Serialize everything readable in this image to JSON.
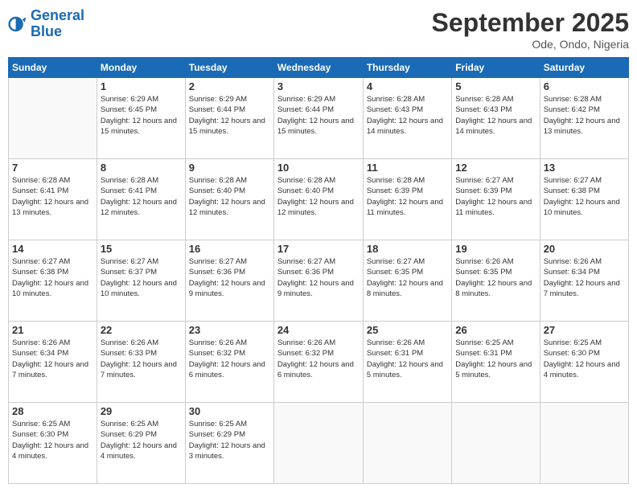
{
  "logo": {
    "line1": "General",
    "line2": "Blue"
  },
  "title": "September 2025",
  "location": "Ode, Ondo, Nigeria",
  "days_of_week": [
    "Sunday",
    "Monday",
    "Tuesday",
    "Wednesday",
    "Thursday",
    "Friday",
    "Saturday"
  ],
  "weeks": [
    [
      {
        "day": "",
        "info": ""
      },
      {
        "day": "1",
        "info": "Sunrise: 6:29 AM\nSunset: 6:45 PM\nDaylight: 12 hours\nand 15 minutes."
      },
      {
        "day": "2",
        "info": "Sunrise: 6:29 AM\nSunset: 6:44 PM\nDaylight: 12 hours\nand 15 minutes."
      },
      {
        "day": "3",
        "info": "Sunrise: 6:29 AM\nSunset: 6:44 PM\nDaylight: 12 hours\nand 15 minutes."
      },
      {
        "day": "4",
        "info": "Sunrise: 6:28 AM\nSunset: 6:43 PM\nDaylight: 12 hours\nand 14 minutes."
      },
      {
        "day": "5",
        "info": "Sunrise: 6:28 AM\nSunset: 6:43 PM\nDaylight: 12 hours\nand 14 minutes."
      },
      {
        "day": "6",
        "info": "Sunrise: 6:28 AM\nSunset: 6:42 PM\nDaylight: 12 hours\nand 13 minutes."
      }
    ],
    [
      {
        "day": "7",
        "info": "Sunrise: 6:28 AM\nSunset: 6:41 PM\nDaylight: 12 hours\nand 13 minutes."
      },
      {
        "day": "8",
        "info": "Sunrise: 6:28 AM\nSunset: 6:41 PM\nDaylight: 12 hours\nand 12 minutes."
      },
      {
        "day": "9",
        "info": "Sunrise: 6:28 AM\nSunset: 6:40 PM\nDaylight: 12 hours\nand 12 minutes."
      },
      {
        "day": "10",
        "info": "Sunrise: 6:28 AM\nSunset: 6:40 PM\nDaylight: 12 hours\nand 12 minutes."
      },
      {
        "day": "11",
        "info": "Sunrise: 6:28 AM\nSunset: 6:39 PM\nDaylight: 12 hours\nand 11 minutes."
      },
      {
        "day": "12",
        "info": "Sunrise: 6:27 AM\nSunset: 6:39 PM\nDaylight: 12 hours\nand 11 minutes."
      },
      {
        "day": "13",
        "info": "Sunrise: 6:27 AM\nSunset: 6:38 PM\nDaylight: 12 hours\nand 10 minutes."
      }
    ],
    [
      {
        "day": "14",
        "info": "Sunrise: 6:27 AM\nSunset: 6:38 PM\nDaylight: 12 hours\nand 10 minutes."
      },
      {
        "day": "15",
        "info": "Sunrise: 6:27 AM\nSunset: 6:37 PM\nDaylight: 12 hours\nand 10 minutes."
      },
      {
        "day": "16",
        "info": "Sunrise: 6:27 AM\nSunset: 6:36 PM\nDaylight: 12 hours\nand 9 minutes."
      },
      {
        "day": "17",
        "info": "Sunrise: 6:27 AM\nSunset: 6:36 PM\nDaylight: 12 hours\nand 9 minutes."
      },
      {
        "day": "18",
        "info": "Sunrise: 6:27 AM\nSunset: 6:35 PM\nDaylight: 12 hours\nand 8 minutes."
      },
      {
        "day": "19",
        "info": "Sunrise: 6:26 AM\nSunset: 6:35 PM\nDaylight: 12 hours\nand 8 minutes."
      },
      {
        "day": "20",
        "info": "Sunrise: 6:26 AM\nSunset: 6:34 PM\nDaylight: 12 hours\nand 7 minutes."
      }
    ],
    [
      {
        "day": "21",
        "info": "Sunrise: 6:26 AM\nSunset: 6:34 PM\nDaylight: 12 hours\nand 7 minutes."
      },
      {
        "day": "22",
        "info": "Sunrise: 6:26 AM\nSunset: 6:33 PM\nDaylight: 12 hours\nand 7 minutes."
      },
      {
        "day": "23",
        "info": "Sunrise: 6:26 AM\nSunset: 6:32 PM\nDaylight: 12 hours\nand 6 minutes."
      },
      {
        "day": "24",
        "info": "Sunrise: 6:26 AM\nSunset: 6:32 PM\nDaylight: 12 hours\nand 6 minutes."
      },
      {
        "day": "25",
        "info": "Sunrise: 6:26 AM\nSunset: 6:31 PM\nDaylight: 12 hours\nand 5 minutes."
      },
      {
        "day": "26",
        "info": "Sunrise: 6:25 AM\nSunset: 6:31 PM\nDaylight: 12 hours\nand 5 minutes."
      },
      {
        "day": "27",
        "info": "Sunrise: 6:25 AM\nSunset: 6:30 PM\nDaylight: 12 hours\nand 4 minutes."
      }
    ],
    [
      {
        "day": "28",
        "info": "Sunrise: 6:25 AM\nSunset: 6:30 PM\nDaylight: 12 hours\nand 4 minutes."
      },
      {
        "day": "29",
        "info": "Sunrise: 6:25 AM\nSunset: 6:29 PM\nDaylight: 12 hours\nand 4 minutes."
      },
      {
        "day": "30",
        "info": "Sunrise: 6:25 AM\nSunset: 6:29 PM\nDaylight: 12 hours\nand 3 minutes."
      },
      {
        "day": "",
        "info": ""
      },
      {
        "day": "",
        "info": ""
      },
      {
        "day": "",
        "info": ""
      },
      {
        "day": "",
        "info": ""
      }
    ]
  ]
}
